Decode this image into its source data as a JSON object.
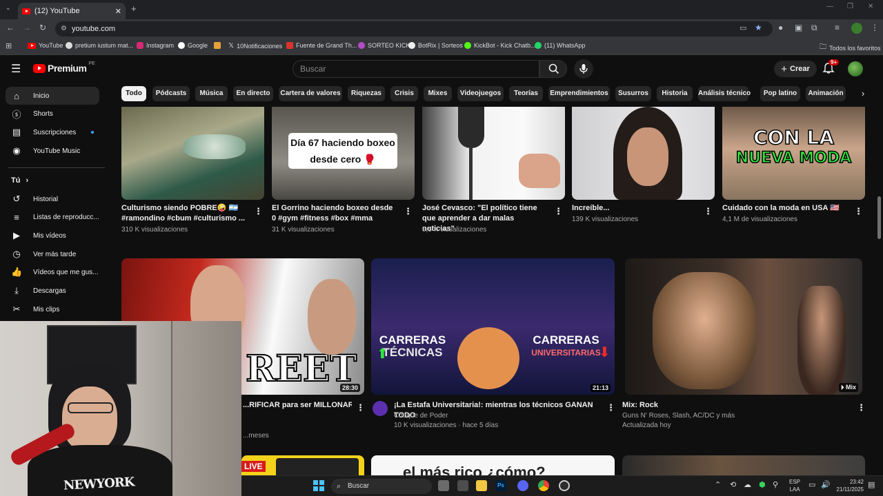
{
  "browser": {
    "tab_title": "(12) YouTube",
    "url": "youtube.com",
    "bookmarks": [
      "YouTube",
      "pretium iustum mat...",
      "Instagram",
      "Google",
      "10Notificaciones",
      "Fuente de Grand Th...",
      "SORTEO KICK",
      "BotRix | Sorteos",
      "KickBot - Kick Chatb...",
      "(11) WhatsApp"
    ],
    "all_bookmarks": "Todos los favoritos"
  },
  "youtube": {
    "logo": "Premium",
    "region": "PE",
    "search_placeholder": "Buscar",
    "create_label": "Crear",
    "notif_count": "9+"
  },
  "chips": [
    "Todo",
    "Pódcasts",
    "Música",
    "En directo",
    "Cartera de valores",
    "Riquezas",
    "Crisis",
    "Mixes",
    "Videojuegos",
    "Teorías",
    "Emprendimientos",
    "Susurros",
    "Historia",
    "Análisis técnico",
    "Pop latino",
    "Animación"
  ],
  "sidebar": {
    "items": [
      {
        "label": "Inicio",
        "icon": "home-icon"
      },
      {
        "label": "Shorts",
        "icon": "shorts-icon"
      },
      {
        "label": "Suscripciones",
        "icon": "subscriptions-icon"
      },
      {
        "label": "YouTube Music",
        "icon": "music-icon"
      }
    ],
    "you_label": "Tú",
    "you_items": [
      {
        "label": "Historial",
        "icon": "history-icon"
      },
      {
        "label": "Listas de reproducc...",
        "icon": "playlist-icon"
      },
      {
        "label": "Mis vídeos",
        "icon": "video-icon"
      },
      {
        "label": "Ver más tarde",
        "icon": "clock-icon"
      },
      {
        "label": "Vídeos que me gus...",
        "icon": "like-icon"
      },
      {
        "label": "Descargas",
        "icon": "download-icon"
      },
      {
        "label": "Mis clips",
        "icon": "scissors-icon"
      }
    ]
  },
  "shorts_row": [
    {
      "title": "Culturismo siendo POBRE🤪 🇦🇷 #ramondino #cbum #culturismo ...",
      "views": "310 K visualizaciones"
    },
    {
      "title": "El Gorrino haciendo boxeo desde 0 #gym #fitness #box #mma",
      "views": "31 K visualizaciones",
      "overlay": [
        "Día 67 haciendo boxeo",
        "desde cero 🥊"
      ]
    },
    {
      "title": "José Cevasco: \"El político tiene que aprender a dar malas noticias\"",
      "views": "9,5 K visualizaciones"
    },
    {
      "title": "Increíble...",
      "views": "139 K visualizaciones"
    },
    {
      "title": "Cuidado con la moda en USA 🇺🇸",
      "views": "4,1 M de visualizaciones",
      "overlay": [
        "CON LA",
        "NUEVA MODA"
      ]
    }
  ],
  "videos": [
    {
      "title": "...RIFICAR para ser MILLONARIO? | ...nes",
      "meta": "...meses",
      "duration": "28:30",
      "thumb_text": "REET"
    },
    {
      "title": "¡La Estafa Universitaria!: mientras los técnicos GANAN TODO",
      "channel": "Choque de Poder",
      "meta": "10 K visualizaciones · hace 5 días",
      "duration": "21:13",
      "thumb_left": [
        "CARRERAS",
        "TÉCNICAS"
      ],
      "thumb_right": [
        "CARRERAS",
        "UNIVERSITARIAS"
      ]
    },
    {
      "title": "Mix: Rock",
      "channel": "Guns N' Roses, Slash, AC/DC y más",
      "meta": "Actualizada hoy",
      "duration": "Mix"
    }
  ],
  "next_row": {
    "live_label": "LIVE",
    "partial_text": "el más rico ¿cómo?"
  },
  "taskbar": {
    "search": "Buscar",
    "lang": "ESP",
    "lang2": "LAA",
    "time": "23:42",
    "date": "21/11/2025"
  }
}
